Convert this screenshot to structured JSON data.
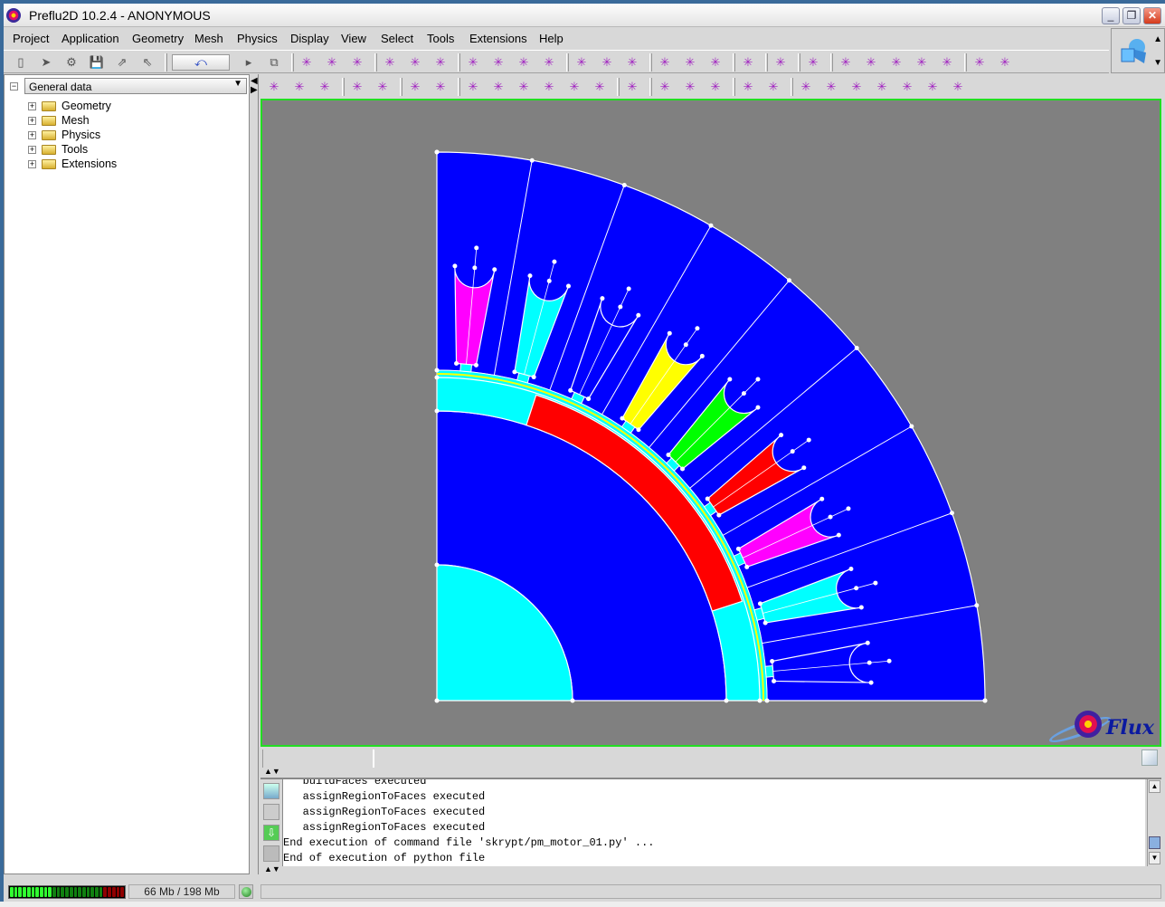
{
  "window": {
    "title": "Preflu2D 10.2.4 - ANONYMOUS",
    "controls": {
      "minimize": "_",
      "restore": "❐",
      "close": "✕"
    }
  },
  "menu": [
    "Project",
    "Application",
    "Geometry",
    "Mesh",
    "Physics",
    "Display",
    "View",
    "Select",
    "Tools",
    "Extensions",
    "Help"
  ],
  "toolbar1": {
    "icons": [
      "new-project-icon",
      "open-project-icon",
      "python-icon",
      "save-icon",
      "export-icon",
      "import-icon",
      "undo-icon",
      "play-icon",
      "close-view-icon",
      "param-geometry-icon",
      "param-sym-icon",
      "param-period-icon",
      "coord-system-icon",
      "transform-icon",
      "param-variable-icon",
      "point-icon",
      "line-icon",
      "build-lines-icon",
      "build-faces-icon",
      "mesh-point-icon",
      "mesh-line-icon",
      "mesh-face-icon",
      "mesh-gen-point-icon",
      "mesh-gen-line-icon",
      "mesh-tool-icon",
      "delete-mesh-icon",
      "mesh-lines-icon",
      "mesh-faces-icon",
      "region-point-icon",
      "region-point2-icon",
      "region-line-icon",
      "region-face-icon",
      "region-volume-icon",
      "check-physics-icon",
      "doctor-icon"
    ]
  },
  "toolbar2": {
    "icons": [
      "rotate-icon",
      "zoom-icon",
      "zoom-region-icon",
      "coord-axes-icon",
      "grid-icon",
      "import-3d-icon",
      "export-3d-icon",
      "axes-xyz-icon",
      "display-points-icon",
      "display-lines-icon",
      "display-faces-icon",
      "cross-points-icon",
      "box-icon",
      "draw-line-icon",
      "draw-face-icon",
      "flag-point-icon",
      "flag-line-icon",
      "curve-icon",
      "mesh-grid-icon",
      "select-none-icon",
      "select-query-icon",
      "select-point-icon",
      "select-line-icon",
      "select-face-icon",
      "select-lines-icon",
      "select-volume-icon"
    ]
  },
  "tree": {
    "dropdown": "General data",
    "items": [
      {
        "label": "Geometry"
      },
      {
        "label": "Mesh"
      },
      {
        "label": "Physics"
      },
      {
        "label": "Tools"
      },
      {
        "label": "Extensions"
      }
    ]
  },
  "viewport": {
    "logo": "Flux",
    "colors": {
      "background": "#808080",
      "iron": "#0000ff",
      "air": "#00ffff",
      "magnet": "#ff0000",
      "border": "#22dd22",
      "airgap_band": "#ffff00"
    },
    "rotor_magnet_span_deg": [
      18,
      72
    ],
    "slots": [
      {
        "phase_color": "#ff00ff",
        "angle_deg": 85
      },
      {
        "phase_color": "#00ffff",
        "angle_deg": 75
      },
      {
        "phase_color": "none",
        "angle_deg": 65
      },
      {
        "phase_color": "#ffff00",
        "angle_deg": 55
      },
      {
        "phase_color": "#00ff00",
        "angle_deg": 45
      },
      {
        "phase_color": "#ff0000",
        "angle_deg": 35
      },
      {
        "phase_color": "#ff00ff",
        "angle_deg": 25
      },
      {
        "phase_color": "#00ffff",
        "angle_deg": 15
      },
      {
        "phase_color": "none",
        "angle_deg": 5
      }
    ]
  },
  "console": {
    "lines": [
      "   buildFaces executed",
      "   assignRegionToFaces executed",
      "   assignRegionToFaces executed",
      "   assignRegionToFaces executed",
      "End execution of command file 'skrypt/pm_motor_01.py' ...",
      "End of execution of python file"
    ]
  },
  "status": {
    "memory": "66 Mb / 198 Mb",
    "memory_used_fraction": 0.33,
    "message": ""
  }
}
